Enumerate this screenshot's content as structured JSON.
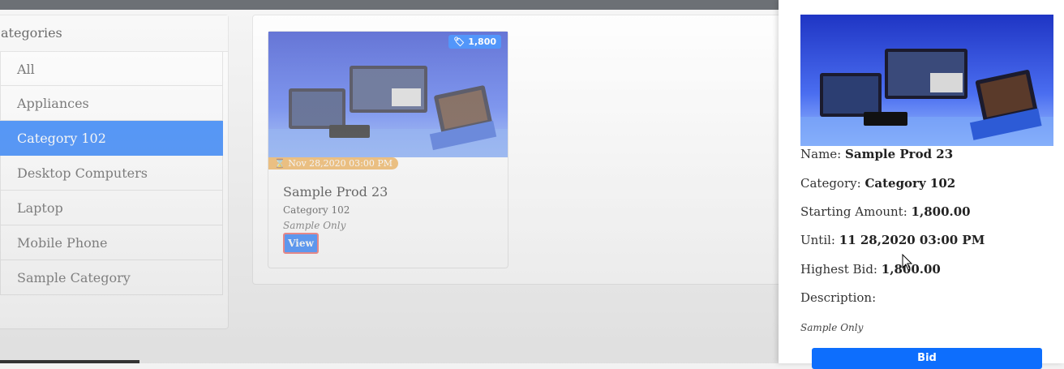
{
  "sidebar": {
    "title": "ategories",
    "items": [
      {
        "label": "All"
      },
      {
        "label": "Appliances"
      },
      {
        "label": "Category 102"
      },
      {
        "label": "Desktop Computers"
      },
      {
        "label": "Laptop"
      },
      {
        "label": "Mobile Phone"
      },
      {
        "label": "Sample Category"
      }
    ],
    "active_index": 2
  },
  "product": {
    "price_badge": "1,800",
    "date_badge": "Nov 28,2020 03:00 PM",
    "title": "Sample Prod 23",
    "category": "Category 102",
    "description": "Sample Only",
    "view_label": "View"
  },
  "detail": {
    "name_label": "Name:",
    "name_value": "Sample Prod 23",
    "category_label": "Category:",
    "category_value": "Category 102",
    "starting_label": "Starting Amount:",
    "starting_value": "1,800.00",
    "until_label": "Until:",
    "until_value": "11 28,2020 03:00 PM",
    "highest_label": "Highest Bid:",
    "highest_value": "1,800.00",
    "description_label": "Description:",
    "description_value": "Sample Only",
    "bid_label": "Bid"
  },
  "colors": {
    "accent": "#0d6efd",
    "date_badge": "#f0ad4e"
  }
}
